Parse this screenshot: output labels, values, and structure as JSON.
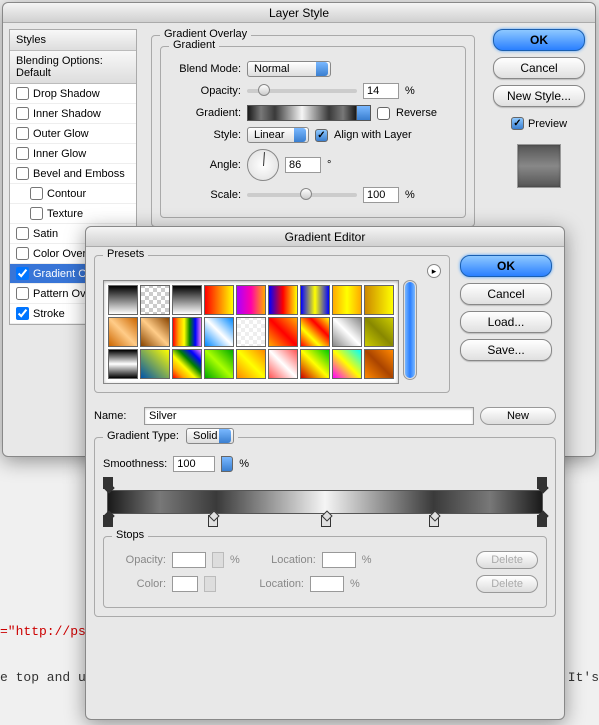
{
  "bg_text": {
    "line1": "=\"http://ps",
    "line2": "e top and u",
    "line3": "s. It's"
  },
  "layer_style": {
    "title": "Layer Style",
    "styles_header": "Styles",
    "blending_header": "Blending Options: Default",
    "items": [
      {
        "label": "Drop Shadow",
        "checked": false
      },
      {
        "label": "Inner Shadow",
        "checked": false
      },
      {
        "label": "Outer Glow",
        "checked": false
      },
      {
        "label": "Inner Glow",
        "checked": false
      },
      {
        "label": "Bevel and Emboss",
        "checked": false
      },
      {
        "label": "Contour",
        "checked": false,
        "indent": true
      },
      {
        "label": "Texture",
        "checked": false,
        "indent": true
      },
      {
        "label": "Satin",
        "checked": false
      },
      {
        "label": "Color Overlay",
        "checked": false
      },
      {
        "label": "Gradient Overlay",
        "checked": true,
        "selected": true
      },
      {
        "label": "Pattern Overlay",
        "checked": false
      },
      {
        "label": "Stroke",
        "checked": true
      }
    ],
    "section_title": "Gradient Overlay",
    "gradient_group": "Gradient",
    "blend_mode_label": "Blend Mode:",
    "blend_mode_value": "Normal",
    "opacity_label": "Opacity:",
    "opacity_value": "14",
    "pct": "%",
    "gradient_label": "Gradient:",
    "reverse_label": "Reverse",
    "style_label": "Style:",
    "style_value": "Linear",
    "align_label": "Align with Layer",
    "angle_label": "Angle:",
    "angle_value": "86",
    "deg": "°",
    "scale_label": "Scale:",
    "scale_value": "100",
    "buttons": {
      "ok": "OK",
      "cancel": "Cancel",
      "new_style": "New Style...",
      "preview": "Preview"
    }
  },
  "gradient_editor": {
    "title": "Gradient Editor",
    "presets_label": "Presets",
    "name_label": "Name:",
    "name_value": "Silver",
    "new_btn": "New",
    "type_label": "Gradient Type:",
    "type_value": "Solid",
    "smoothness_label": "Smoothness:",
    "smoothness_value": "100",
    "pct": "%",
    "stops_label": "Stops",
    "opacity_label": "Opacity:",
    "location_label": "Location:",
    "color_label": "Color:",
    "delete_btn": "Delete",
    "buttons": {
      "ok": "OK",
      "cancel": "Cancel",
      "load": "Load...",
      "save": "Save..."
    },
    "preset_gradients": [
      "linear-gradient(#000,#fff)",
      "repeating-conic-gradient(#ccc 0 25%,#fff 0 50%) 0/8px 8px",
      "linear-gradient(#000,#fff)",
      "linear-gradient(90deg,red,#ff0)",
      "linear-gradient(90deg,#a0f,#f0a,#fa0)",
      "linear-gradient(90deg,#00f,#f00,#ff0)",
      "linear-gradient(90deg,#00f,#ff0,#00f)",
      "linear-gradient(90deg,#fa0,#ff0,#fa0)",
      "linear-gradient(90deg,#c80,#ff0)",
      "linear-gradient(45deg,#c60,#fc8,#c60)",
      "linear-gradient(45deg,#840,#fc8,#840)",
      "linear-gradient(90deg,red,orange,yellow,green,blue,violet)",
      "linear-gradient(45deg,#08f,#fff,#08f)",
      "repeating-conic-gradient(#eee 0 25%,#fff 0 50%) 0/8px 8px",
      "linear-gradient(45deg,#fa0,#f00,#fa0)",
      "linear-gradient(45deg,#f00,#ff0,#f00,#ff0)",
      "linear-gradient(45deg,#888,#fff,#888)",
      "linear-gradient(45deg,#cc0,#880,#cc0)",
      "linear-gradient(#000,#fff,#000)",
      "linear-gradient(45deg,#05a,#ff0)",
      "linear-gradient(45deg,red,orange,yellow,green,blue,violet)",
      "linear-gradient(45deg,#0a0,#af0,#0a0)",
      "linear-gradient(45deg,#f80,#ff0,#f80)",
      "linear-gradient(45deg,#f55,#fff,#f55)",
      "linear-gradient(45deg,#c00,#ff0,#0c0)",
      "linear-gradient(45deg,#f0f,#ff0,#0ff)",
      "linear-gradient(45deg,#f80,#a40,#f80)"
    ]
  }
}
